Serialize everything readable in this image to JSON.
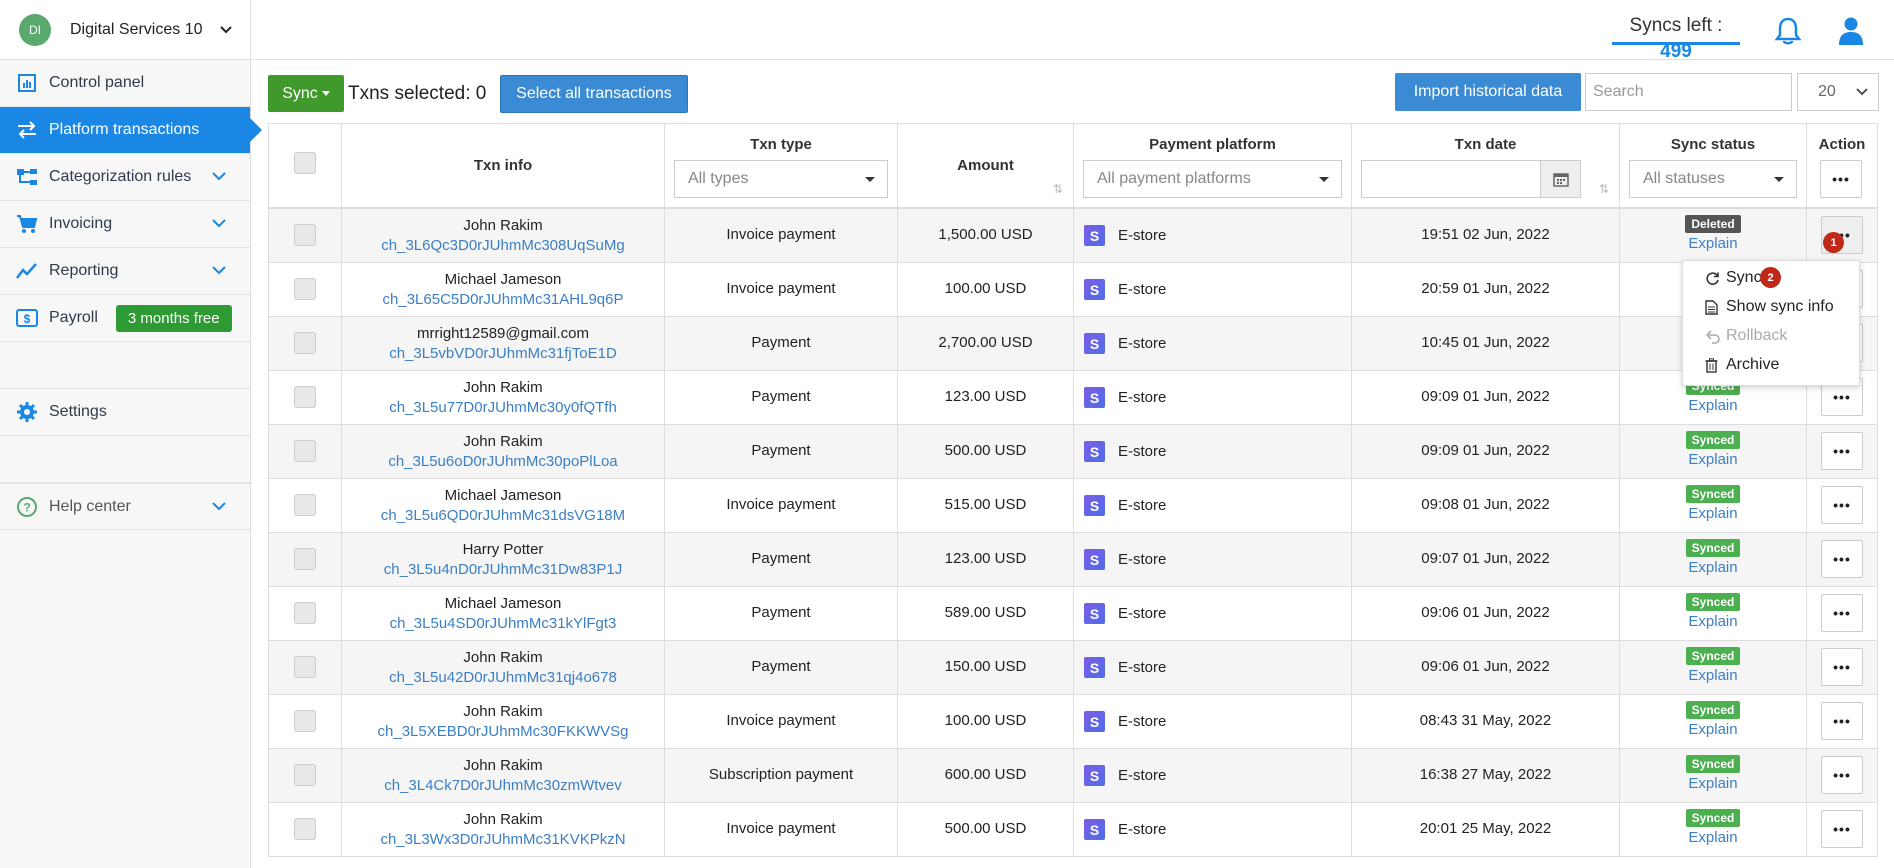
{
  "org": {
    "initials": "DI",
    "name": "Digital Services 10"
  },
  "nav": {
    "control_panel": "Control panel",
    "platform_transactions": "Platform transactions",
    "categorization_rules": "Categorization rules",
    "invoicing": "Invoicing",
    "reporting": "Reporting",
    "payroll": "Payroll",
    "payroll_badge": "3 months free",
    "settings": "Settings",
    "help_center": "Help center"
  },
  "header": {
    "syncs_left_label": "Syncs left :",
    "syncs_left_value": "499"
  },
  "toolbar": {
    "sync_label": "Sync",
    "txns_selected": "Txns selected: 0",
    "select_all": "Select all transactions",
    "import": "Import historical data",
    "search_placeholder": "Search",
    "per_page": "20"
  },
  "columns": {
    "txn_info": "Txn info",
    "txn_type": "Txn type",
    "txn_type_filter": "All types",
    "amount": "Amount",
    "payment_platform": "Payment platform",
    "platform_filter": "All payment platforms",
    "txn_date": "Txn date",
    "sync_status": "Sync status",
    "status_filter": "All statuses",
    "action": "Action"
  },
  "colors": {
    "synced": "#4caf50",
    "deleted": "#555555",
    "accent": "#1a87e4"
  },
  "rows": [
    {
      "name": "John Rakim",
      "id": "ch_3L6Qc3D0rJUhmMc308UqSuMg",
      "type": "Invoice payment",
      "amount": "1,500.00 USD",
      "platform": "E-store",
      "date": "19:51 02 Jun, 2022",
      "status": "Deleted",
      "explain": "Explain"
    },
    {
      "name": "Michael Jameson",
      "id": "ch_3L65C5D0rJUhmMc31AHL9q6P",
      "type": "Invoice payment",
      "amount": "100.00 USD",
      "platform": "E-store",
      "date": "20:59 01 Jun, 2022",
      "status": "",
      "explain": ""
    },
    {
      "name": "mrright12589@gmail.com",
      "id": "ch_3L5vbVD0rJUhmMc31fjToE1D",
      "type": "Payment",
      "amount": "2,700.00 USD",
      "platform": "E-store",
      "date": "10:45 01 Jun, 2022",
      "status": "",
      "explain": ""
    },
    {
      "name": "John Rakim",
      "id": "ch_3L5u77D0rJUhmMc30y0fQTfh",
      "type": "Payment",
      "amount": "123.00 USD",
      "platform": "E-store",
      "date": "09:09 01 Jun, 2022",
      "status": "Synced",
      "explain": "Explain"
    },
    {
      "name": "John Rakim",
      "id": "ch_3L5u6oD0rJUhmMc30poPlLoa",
      "type": "Payment",
      "amount": "500.00 USD",
      "platform": "E-store",
      "date": "09:09 01 Jun, 2022",
      "status": "Synced",
      "explain": "Explain"
    },
    {
      "name": "Michael Jameson",
      "id": "ch_3L5u6QD0rJUhmMc31dsVG18M",
      "type": "Invoice payment",
      "amount": "515.00 USD",
      "platform": "E-store",
      "date": "09:08 01 Jun, 2022",
      "status": "Synced",
      "explain": "Explain"
    },
    {
      "name": "Harry Potter",
      "id": "ch_3L5u4nD0rJUhmMc31Dw83P1J",
      "type": "Payment",
      "amount": "123.00 USD",
      "platform": "E-store",
      "date": "09:07 01 Jun, 2022",
      "status": "Synced",
      "explain": "Explain"
    },
    {
      "name": "Michael Jameson",
      "id": "ch_3L5u4SD0rJUhmMc31kYlFgt3",
      "type": "Payment",
      "amount": "589.00 USD",
      "platform": "E-store",
      "date": "09:06 01 Jun, 2022",
      "status": "Synced",
      "explain": "Explain"
    },
    {
      "name": "John Rakim",
      "id": "ch_3L5u42D0rJUhmMc31qj4o678",
      "type": "Payment",
      "amount": "150.00 USD",
      "platform": "E-store",
      "date": "09:06 01 Jun, 2022",
      "status": "Synced",
      "explain": "Explain"
    },
    {
      "name": "John Rakim",
      "id": "ch_3L5XEBD0rJUhmMc30FKKWVSg",
      "type": "Invoice payment",
      "amount": "100.00 USD",
      "platform": "E-store",
      "date": "08:43 31 May, 2022",
      "status": "Synced",
      "explain": "Explain"
    },
    {
      "name": "John Rakim",
      "id": "ch_3L4Ck7D0rJUhmMc30zmWtvev",
      "type": "Subscription payment",
      "amount": "600.00 USD",
      "platform": "E-store",
      "date": "16:38 27 May, 2022",
      "status": "Synced",
      "explain": "Explain"
    },
    {
      "name": "John Rakim",
      "id": "ch_3L3Wx3D0rJUhmMc31KVKPkzN",
      "type": "Invoice payment",
      "amount": "500.00 USD",
      "platform": "E-store",
      "date": "20:01 25 May, 2022",
      "status": "Synced",
      "explain": "Explain"
    }
  ],
  "dropdown": {
    "sync": "Sync",
    "show_sync_info": "Show sync info",
    "rollback": "Rollback",
    "archive": "Archive"
  },
  "markers": {
    "m1": "1",
    "m2": "2"
  },
  "icons": [
    "chart-icon",
    "transfer-icon",
    "hierarchy-icon",
    "cart-icon",
    "trend-icon",
    "dollar-icon",
    "gear-icon",
    "help-icon",
    "bell-icon",
    "user-icon",
    "calendar-icon",
    "refresh-icon",
    "document-icon",
    "undo-icon",
    "trash-icon"
  ]
}
